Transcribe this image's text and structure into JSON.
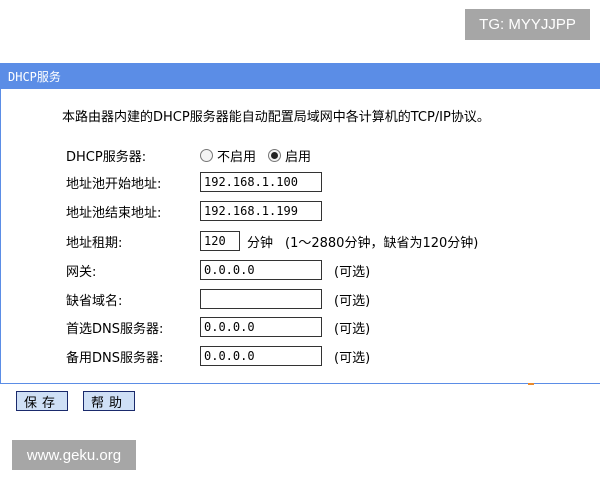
{
  "watermarks": {
    "top": "TG: MYYJJPP",
    "bottom": "www.geku.org"
  },
  "panel": {
    "title": "DHCP服务",
    "description": "本路由器内建的DHCP服务器能自动配置局域网中各计算机的TCP/IP协议。"
  },
  "form": {
    "dhcp_server": {
      "label": "DHCP服务器:",
      "options": [
        "不启用",
        "启用"
      ],
      "selected": "启用"
    },
    "pool_start": {
      "label": "地址池开始地址:",
      "value": "192.168.1.100"
    },
    "pool_end": {
      "label": "地址池结束地址:",
      "value": "192.168.1.199"
    },
    "lease": {
      "label": "地址租期:",
      "value": "120",
      "unit": "分钟",
      "note": "(1～2880分钟，缺省为120分钟)"
    },
    "gateway": {
      "label": "网关:",
      "value": "0.0.0.0",
      "note": "(可选)"
    },
    "domain": {
      "label": "缺省域名:",
      "value": "",
      "note": "(可选)"
    },
    "dns_primary": {
      "label": "首选DNS服务器:",
      "value": "0.0.0.0",
      "note": "(可选)"
    },
    "dns_secondary": {
      "label": "备用DNS服务器:",
      "value": "0.0.0.0",
      "note": "(可选)"
    }
  },
  "buttons": {
    "save": "保存",
    "help": "帮助"
  },
  "colors": {
    "titlebar": "#5b8de6",
    "button_bg": "#cfe0f6",
    "button_border": "#1a2a6c"
  }
}
